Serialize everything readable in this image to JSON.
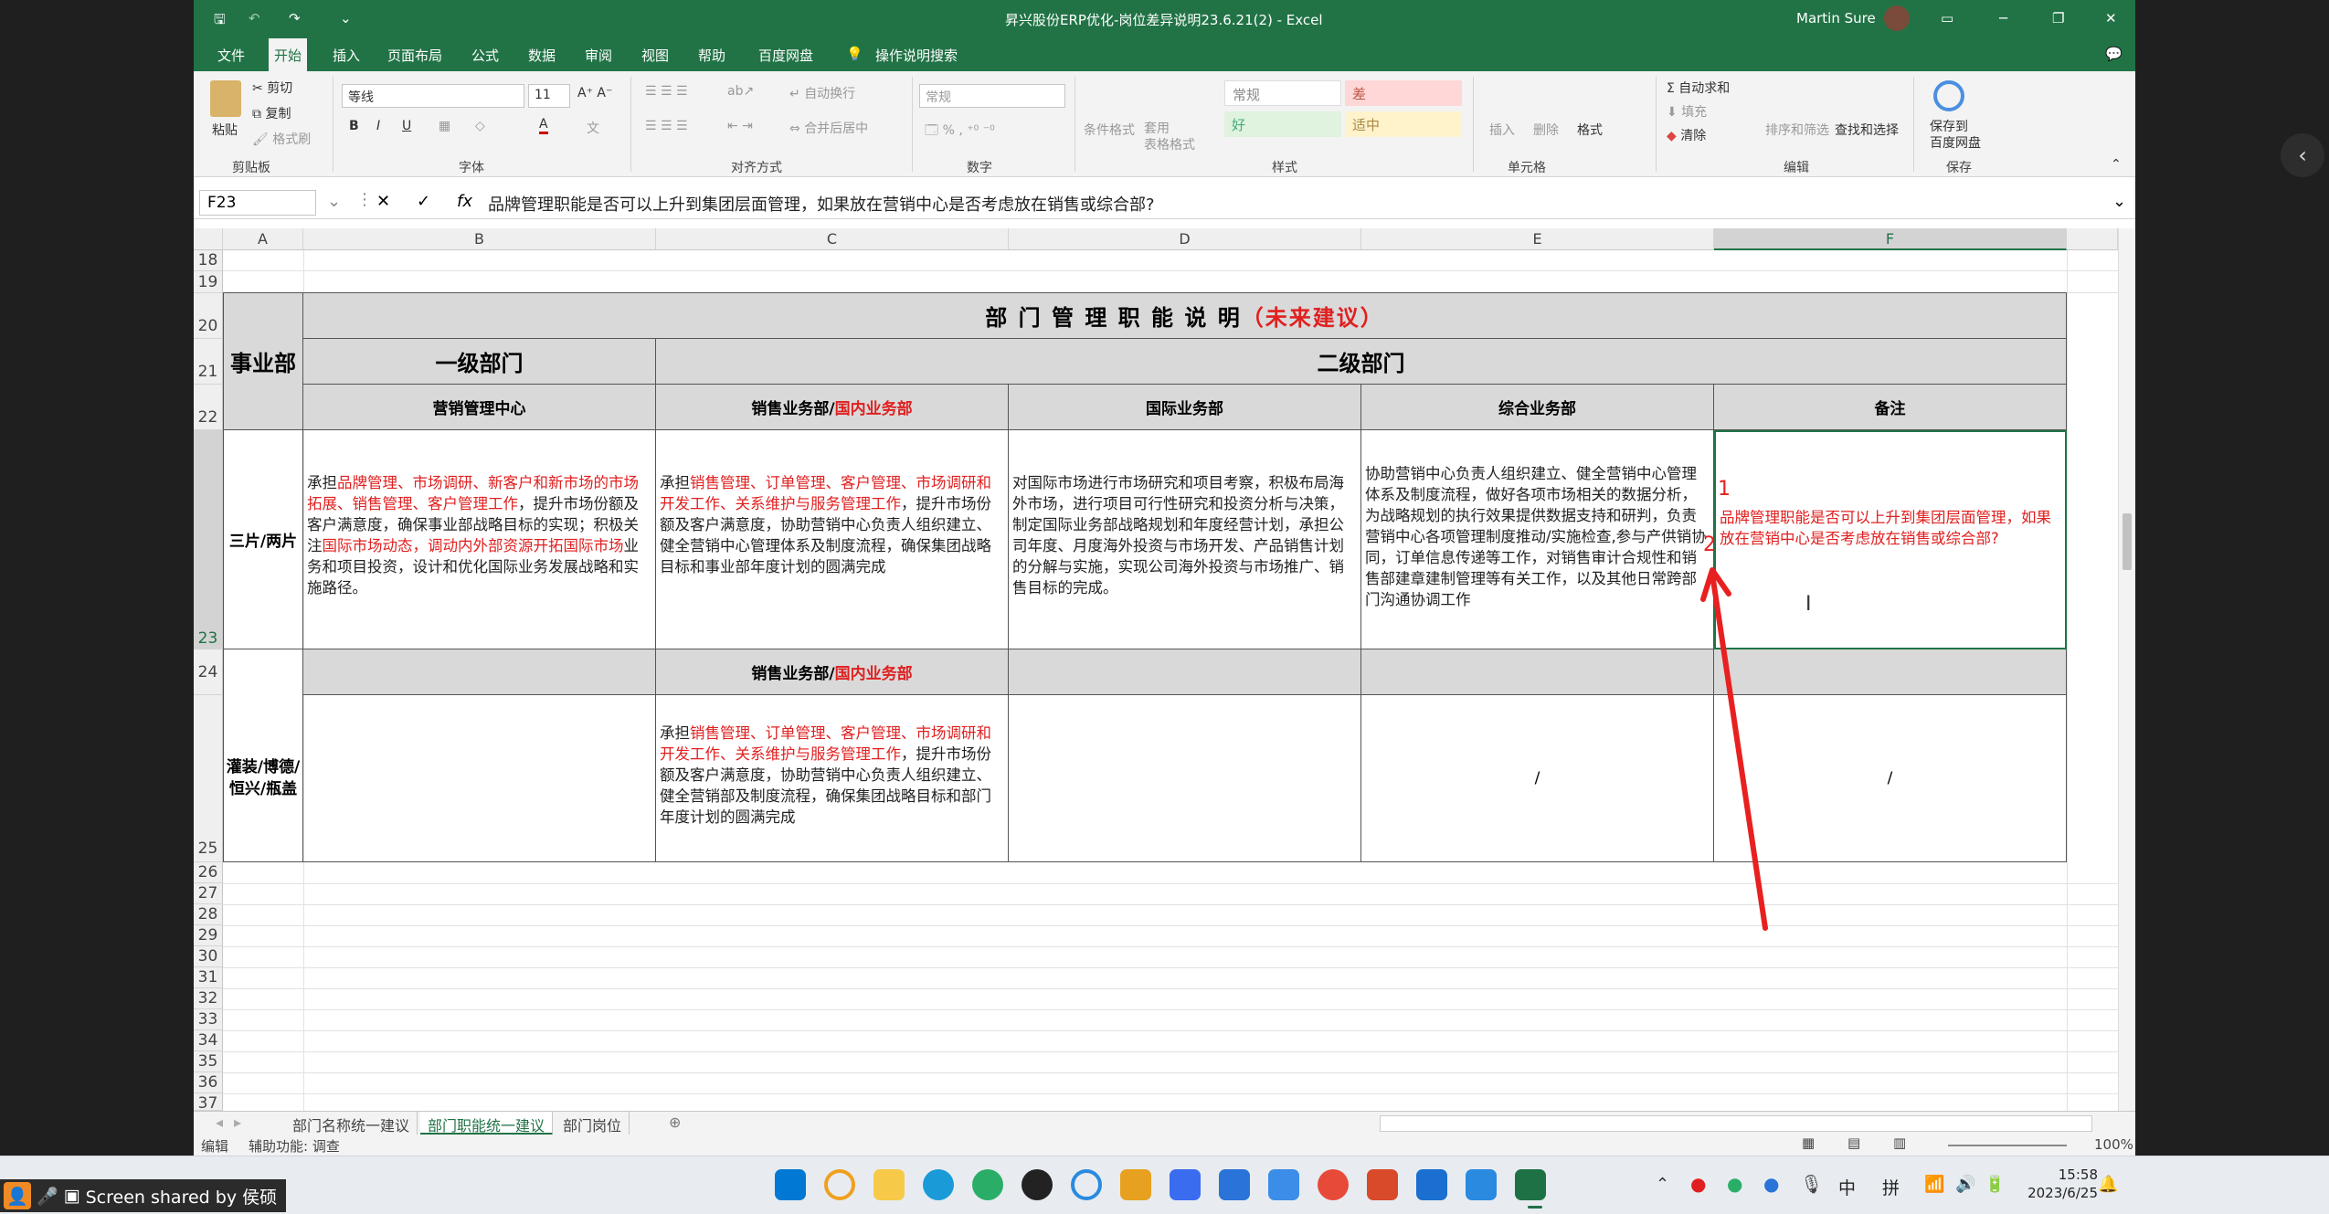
{
  "window": {
    "title": "昇兴股份ERP优化-岗位差异说明23.6.21(2)  -  Excel",
    "user": "Martin Sure"
  },
  "ribbon_tabs": [
    "文件",
    "开始",
    "插入",
    "页面布局",
    "公式",
    "数据",
    "审阅",
    "视图",
    "帮助",
    "百度网盘",
    "操作说明搜索"
  ],
  "ribbon": {
    "clipboard": {
      "paste": "粘贴",
      "cut": "剪切",
      "copy": "复制",
      "format_painter": "格式刷",
      "label": "剪贴板"
    },
    "font": {
      "name": "等线",
      "size": "11",
      "label": "字体"
    },
    "align": {
      "wrap": "自动换行",
      "merge": "合并后居中",
      "label": "对齐方式"
    },
    "number": {
      "format": "常规",
      "label": "数字"
    },
    "styles": {
      "cond": "条件格式",
      "table": "套用\n表格格式",
      "normal": "常规",
      "bad": "差",
      "good": "好",
      "neutral": "适中",
      "label": "样式"
    },
    "cells": {
      "insert": "插入",
      "delete": "删除",
      "format": "格式",
      "label": "单元格"
    },
    "editing": {
      "autosum": "自动求和",
      "fill": "填充",
      "clear": "清除",
      "sort": "排序和筛选",
      "find": "查找和选择",
      "label": "编辑"
    },
    "save": {
      "baidu": "保存到\n百度网盘",
      "label": "保存"
    }
  },
  "formula_bar": {
    "name_box": "F23",
    "fx": "fx",
    "content": "品牌管理职能是否可以上升到集团层面管理，如果放在营销中心是否考虑放在销售或综合部?"
  },
  "columns": [
    "A",
    "B",
    "C",
    "D",
    "E",
    "F"
  ],
  "rows_top": [
    "18",
    "19"
  ],
  "rows_bottom": [
    "26",
    "27",
    "28",
    "29",
    "30",
    "31",
    "32",
    "33",
    "34",
    "35",
    "36",
    "37"
  ],
  "table": {
    "title_black": "部 门 管 理 职 能 说 明",
    "title_red": "（未来建议）",
    "business_unit": "事业部",
    "level1": "一级部门",
    "level2": "二级部门",
    "headers": {
      "b": "营销管理中心",
      "c_black": "销售业务部/",
      "c_red": "国内业务部",
      "d": "国际业务部",
      "e": "综合业务部",
      "f": "备注"
    },
    "row23": {
      "label": "三片/两片",
      "b": [
        {
          "t": "承担",
          "r": false
        },
        {
          "t": "品牌管理、市场调研、新客户和新市场的市场拓展、销售管理、客户管理工作",
          "r": true
        },
        {
          "t": "，提升市场份额及客户满意度，确保事业部战略目标的实现；积极关注",
          "r": false
        },
        {
          "t": "国际市场动态，调动内外部资源开拓国际市场",
          "r": true
        },
        {
          "t": "业务和项目投资，设计和优化国际业务发展战略和实施路径。",
          "r": false
        }
      ],
      "c": [
        {
          "t": "承担",
          "r": false
        },
        {
          "t": "销售管理、订单管理、客户管理、市场调研和开发工作、关系维护与服务管理工作",
          "r": true
        },
        {
          "t": "，提升市场份额及客户满意度，协助营销中心负责人组织建立、健全营销中心管理体系及制度流程，确保集团战略目标和事业部年度计划的圆满完成",
          "r": false
        }
      ],
      "d": "对国际市场进行市场研究和项目考察，积极布局海外市场，进行项目可行性研究和投资分析与决策，制定国际业务部战略规划和年度经营计划，承担公司年度、月度海外投资与市场开发、产品销售计划的分解与实施，实现公司海外投资与市场推广、销售目标的完成。",
      "e": "协助营销中心负责人组织建立、健全营销中心管理体系及制度流程，做好各项市场相关的数据分析，为战略规划的执行效果提供数据支持和研判，负责营销中心各项管理制度推动/实施检查,参与产供销协同，订单信息传递等工作，对销售审计合规性和销售部建章建制管理等有关工作，以及其他日常跨部门沟通协调工作",
      "f_mark1": "1",
      "f_mark2": "2",
      "f": "品牌管理职能是否可以上升到集团层面管理，如果放在营销中心是否考虑放在销售或综合部?"
    },
    "row24": {
      "c_black": "销售业务部/",
      "c_red": "国内业务部"
    },
    "row25": {
      "label": "灌装/博德/恒兴/瓶盖",
      "c": [
        {
          "t": "承担",
          "r": false
        },
        {
          "t": "销售管理、订单管理、客户管理、市场调研和开发工作、关系维护与服务管理工作",
          "r": true
        },
        {
          "t": "，提升市场份额及客户满意度，协助营销中心负责人组织建立、健全营销部及制度流程，确保集团战略目标和部门年度计划的圆满完成",
          "r": false
        }
      ],
      "e": "/",
      "f": "/"
    }
  },
  "sheet_tabs": [
    "部门名称统一建议",
    "部门职能统一建议",
    "部门岗位"
  ],
  "active_sheet": 1,
  "status": {
    "mode": "编辑",
    "accessibility": "辅助功能: 调查",
    "zoom": "100%"
  },
  "taskbar": {
    "time": "15:58",
    "date": "2023/6/25",
    "ime1": "中",
    "ime2": "拼",
    "share": "Screen shared by 侯硕"
  },
  "colors": {
    "excel_green": "#217346",
    "annotation_red": "#e82020",
    "table_gray": "#d9d9d9"
  }
}
